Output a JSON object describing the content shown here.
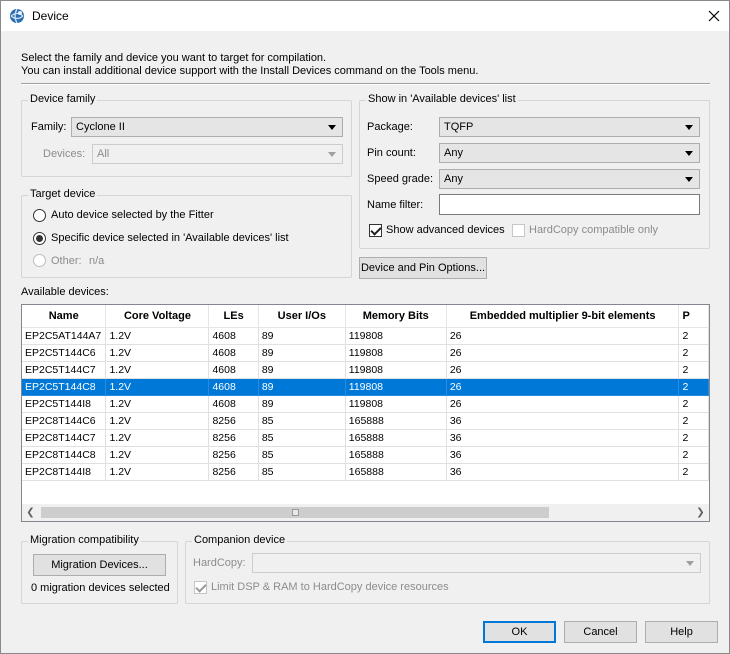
{
  "window": {
    "title": "Device"
  },
  "intro": {
    "line1": "Select the family and device you want to target for compilation.",
    "line2": "You can install additional device support with the Install Devices command on the Tools menu."
  },
  "device_family": {
    "title": "Device family",
    "family_label": "Family:",
    "family_value": "Cyclone II",
    "devices_label": "Devices:",
    "devices_value": "All"
  },
  "target_device": {
    "title": "Target device",
    "auto_label": "Auto device selected by the Fitter",
    "specific_label": "Specific device selected in 'Available devices' list",
    "other_label": "Other:",
    "other_value": "n/a",
    "selected_option": "specific"
  },
  "show_in": {
    "title": "Show in 'Available devices' list",
    "package_label": "Package:",
    "package_value": "TQFP",
    "pin_count_label": "Pin count:",
    "pin_count_value": "Any",
    "speed_grade_label": "Speed grade:",
    "speed_grade_value": "Any",
    "name_filter_label": "Name filter:",
    "name_filter_value": "",
    "show_advanced_label": "Show advanced devices",
    "show_advanced_checked": true,
    "hardcopy_only_label": "HardCopy compatible only",
    "hardcopy_only_checked": false
  },
  "device_pin_options_label": "Device and Pin Options...",
  "available": {
    "title": "Available devices:",
    "columns": [
      "Name",
      "Core Voltage",
      "LEs",
      "User I/Os",
      "Memory Bits",
      "Embedded multiplier 9-bit elements",
      "P"
    ],
    "rows": [
      [
        "EP2C5AT144A7",
        "1.2V",
        "4608",
        "89",
        "119808",
        "26",
        "2"
      ],
      [
        "EP2C5T144C6",
        "1.2V",
        "4608",
        "89",
        "119808",
        "26",
        "2"
      ],
      [
        "EP2C5T144C7",
        "1.2V",
        "4608",
        "89",
        "119808",
        "26",
        "2"
      ],
      [
        "EP2C5T144C8",
        "1.2V",
        "4608",
        "89",
        "119808",
        "26",
        "2"
      ],
      [
        "EP2C5T144I8",
        "1.2V",
        "4608",
        "89",
        "119808",
        "26",
        "2"
      ],
      [
        "EP2C8T144C6",
        "1.2V",
        "8256",
        "85",
        "165888",
        "36",
        "2"
      ],
      [
        "EP2C8T144C7",
        "1.2V",
        "8256",
        "85",
        "165888",
        "36",
        "2"
      ],
      [
        "EP2C8T144C8",
        "1.2V",
        "8256",
        "85",
        "165888",
        "36",
        "2"
      ],
      [
        "EP2C8T144I8",
        "1.2V",
        "8256",
        "85",
        "165888",
        "36",
        "2"
      ]
    ],
    "selected_row": 3
  },
  "migration": {
    "title": "Migration compatibility",
    "button_label": "Migration Devices...",
    "status": "0 migration devices selected"
  },
  "companion": {
    "title": "Companion device",
    "hardcopy_label": "HardCopy:",
    "hardcopy_value": "",
    "limit_label": "Limit DSP & RAM to HardCopy device resources",
    "limit_checked": true
  },
  "buttons": {
    "ok": "OK",
    "cancel": "Cancel",
    "help": "Help"
  },
  "colors": {
    "selection": "#0078d7",
    "dialog_bg": "#f0f0f0"
  }
}
